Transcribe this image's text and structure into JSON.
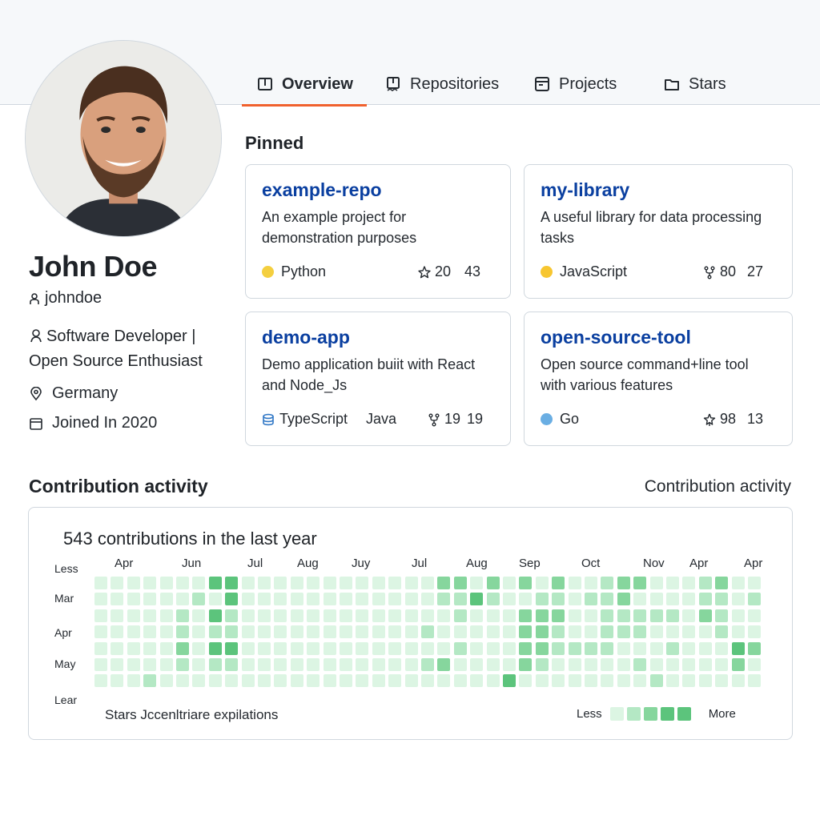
{
  "tabs": [
    {
      "label": "Overview",
      "icon": "book-icon",
      "active": true
    },
    {
      "label": "Repositories",
      "icon": "repo-icon",
      "active": false
    },
    {
      "label": "Projects",
      "icon": "table-icon",
      "active": false
    },
    {
      "label": "Stars",
      "icon": "folder-icon",
      "active": false
    }
  ],
  "profile": {
    "name": "John Doe",
    "handle": "johndoe",
    "bio": "Software Developer | Open Source Enthusiast",
    "location": "Germany",
    "joined": "Joined In 2020"
  },
  "pinned": {
    "title": "Pinned",
    "cards": [
      {
        "name": "example-repo",
        "description": "An example project for demonstration purposes",
        "language": "Python",
        "lang_color": "#f4cf3f",
        "second_language": "",
        "stat_a": "20",
        "stat_a_icon": "star-icon",
        "stat_b": "43"
      },
      {
        "name": "my-library",
        "description": "A useful library for data processing tasks",
        "language": "JavaScript",
        "lang_color": "#f7c630",
        "second_language": "",
        "stat_a": "80",
        "stat_a_icon": "fork-icon",
        "stat_b": "27"
      },
      {
        "name": "demo-app",
        "description": "Demo application buiit with React and Node_Js",
        "language": "TypeScript",
        "lang_color": "#3178c6",
        "second_language": "Java",
        "stat_a": "19",
        "stat_a_icon": "fork-icon",
        "stat_b": "19"
      },
      {
        "name": "open-source-tool",
        "description": "Open source command+line tool with various features",
        "language": "Go",
        "lang_color": "#6aaee3",
        "second_language": "",
        "stat_a": "98",
        "stat_a_icon": "pin-icon",
        "stat_b": "13"
      }
    ]
  },
  "contributions": {
    "title": "Contribution activity",
    "link": "Contribution activity",
    "count": "543 contributions  in the last year",
    "months": [
      "Apr",
      "Jun",
      "Jul",
      "Aug",
      "Juy",
      "Jul",
      "Aug",
      "Sep",
      "Oct",
      "Nov",
      "Apr",
      "Apr"
    ],
    "day_labels": [
      "Less",
      "Mar",
      "Apr",
      "May",
      "Lear"
    ],
    "footer": "Stars Jccenltriare expilations",
    "legend_less": "Less",
    "legend_more": "More",
    "palette": [
      "#dcf5e3",
      "#b4e8c4",
      "#86d69d",
      "#5cc47c"
    ],
    "levels": [
      "00000003300000000000022020202001220001200",
      "00000010300000000000011310011011200001101",
      "00000103100000000000001000222001111102100",
      "00000101100000000000100000221001110000100",
      "00000203300000000000001000221111000100032",
      "00000101100000000000120000210000010000020",
      "00010000000000000000000003000000001000000"
    ]
  }
}
